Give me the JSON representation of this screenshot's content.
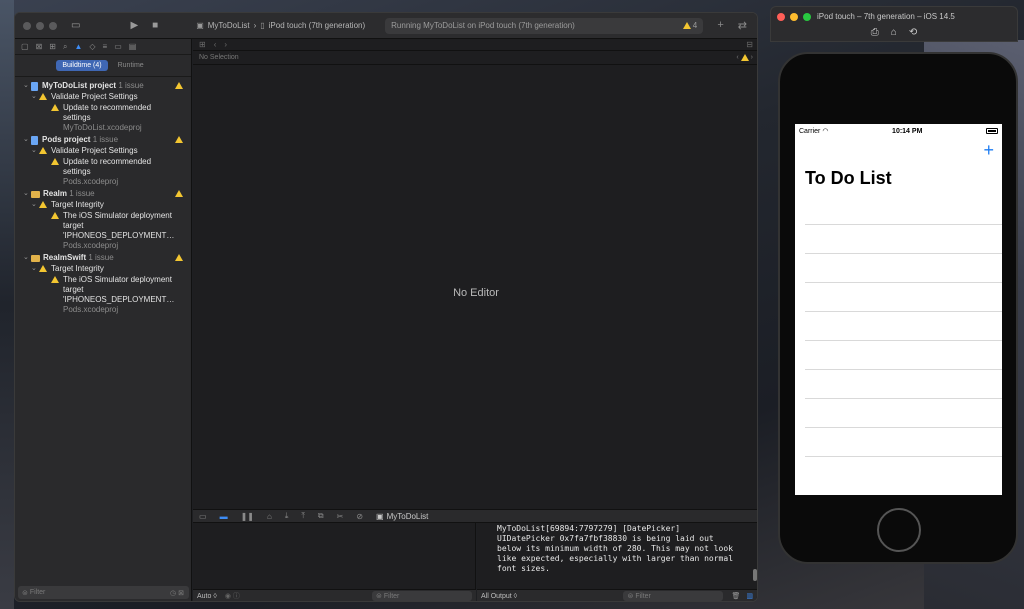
{
  "xcode": {
    "scheme_project": "MyToDoList",
    "scheme_device": "iPod touch (7th generation)",
    "status_text": "Running MyToDoList on iPod touch (7th generation)",
    "status_warning_count": "4",
    "navigator": {
      "tab_buildtime": "Buildtime (4)",
      "tab_runtime": "Runtime",
      "groups": [
        {
          "title": "MyToDoList project",
          "count": "1 issue",
          "category": "Validate Project Settings",
          "issue": "Update to recommended settings",
          "file": "MyToDoList.xcodeproj"
        },
        {
          "title": "Pods project",
          "count": "1 issue",
          "category": "Validate Project Settings",
          "issue": "Update to recommended settings",
          "file": "Pods.xcodeproj"
        },
        {
          "title": "Realm",
          "count": "1 issue",
          "category": "Target Integrity",
          "issue": "The iOS Simulator deployment target 'IPHONEOS_DEPLOYMENT…",
          "file": "Pods.xcodeproj"
        },
        {
          "title": "RealmSwift",
          "count": "1 issue",
          "category": "Target Integrity",
          "issue": "The iOS Simulator deployment target 'IPHONEOS_DEPLOYMENT…",
          "file": "Pods.xcodeproj"
        }
      ],
      "filter_placeholder": "Filter"
    },
    "editor": {
      "jump_label": "No Selection",
      "empty_label": "No Editor"
    },
    "debug": {
      "target_label": "MyToDoList",
      "auto_label": "Auto ◊",
      "filter_placeholder": "Filter",
      "output_label": "All Output ◊",
      "console_text": "MyToDoList[69894:7797279] [DatePicker]\nUIDatePicker 0x7fa7fbf38830 is being laid out\nbelow its minimum width of 280. This may not look\nlike expected, especially with larger than normal\nfont sizes."
    }
  },
  "simulator": {
    "title": "iPod touch – 7th generation – iOS 14.5",
    "carrier": "Carrier",
    "time": "10:14 PM",
    "nav_title": "To Do List",
    "add_symbol": "+"
  },
  "colors": {
    "accent": "#3d8cf5",
    "warning": "#f3c631",
    "ios_tint": "#1d7cf2"
  }
}
